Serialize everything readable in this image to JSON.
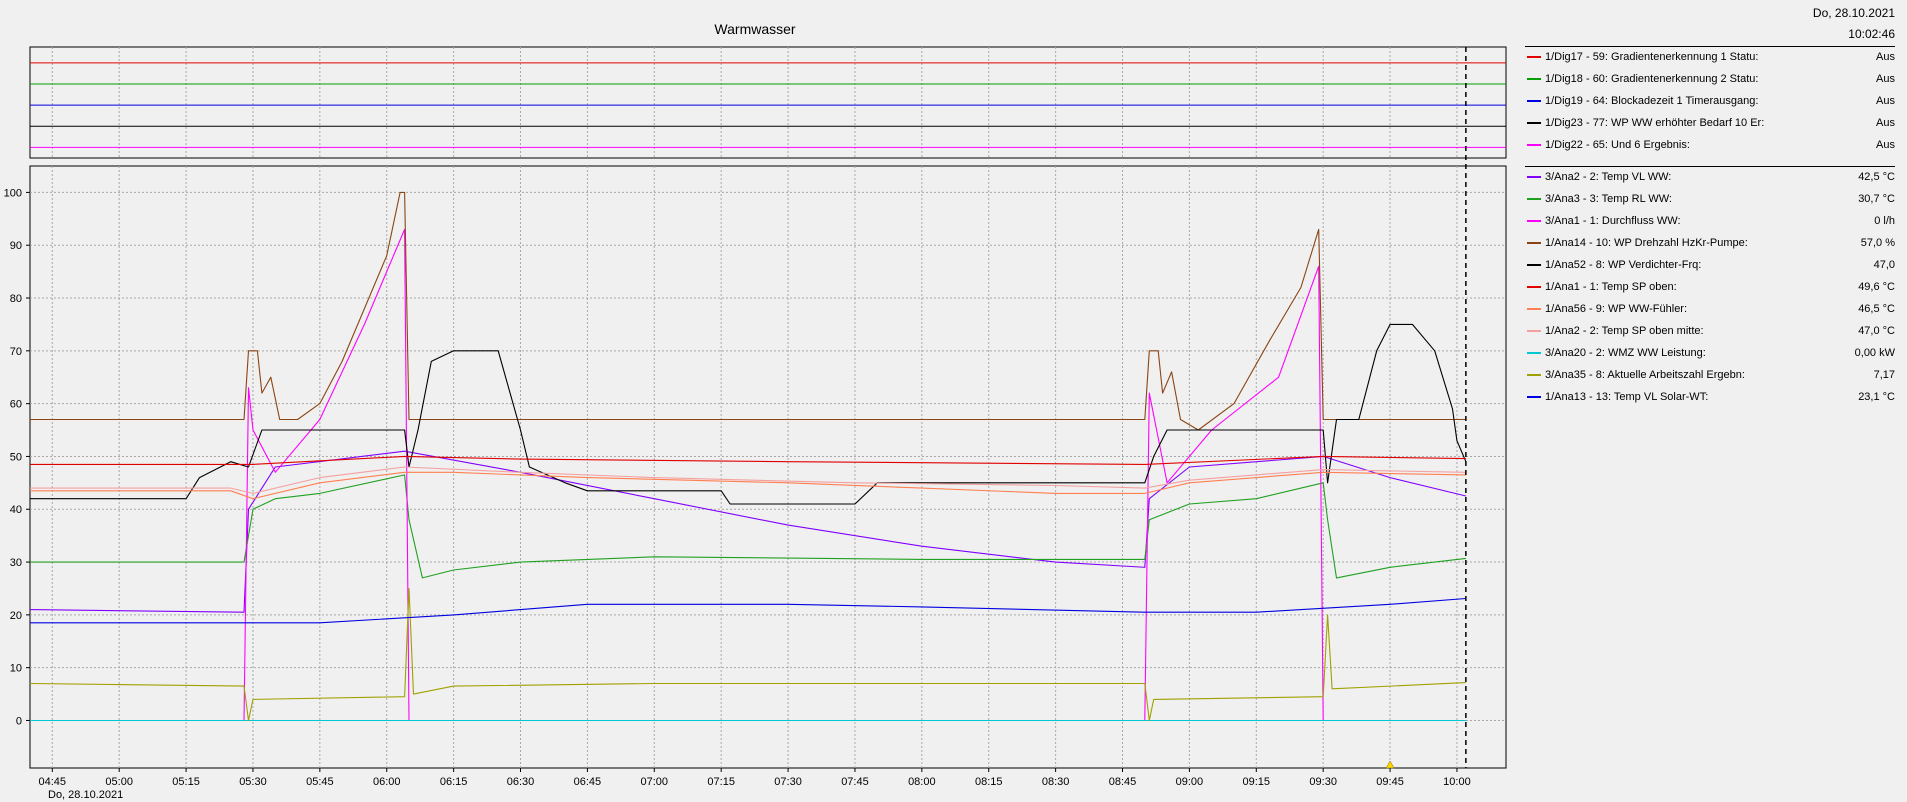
{
  "header": {
    "title": "Warmwasser",
    "date": "Do, 28.10.2021",
    "time": "10:02:46",
    "x_date": "Do, 28.10.2021"
  },
  "legend_digital": [
    {
      "label": "1/Dig17 - 59: Gradientenerkennung 1 Statu:",
      "value": "Aus",
      "color": "#e00000"
    },
    {
      "label": "1/Dig18 - 60: Gradientenerkennung 2 Statu:",
      "value": "Aus",
      "color": "#00a000"
    },
    {
      "label": "1/Dig19 - 64: Blockadezeit 1 Timerausgang:",
      "value": "Aus",
      "color": "#0000e0"
    },
    {
      "label": "1/Dig23 - 77: WP WW erhöhter Bedarf 10 Er:",
      "value": "Aus",
      "color": "#000000"
    },
    {
      "label": "1/Dig22 - 65: Und 6 Ergebnis:",
      "value": "Aus",
      "color": "#ff00ff"
    }
  ],
  "legend_analog": [
    {
      "label": "3/Ana2 - 2: Temp VL WW:",
      "value": "42,5 °C",
      "color": "#8000ff"
    },
    {
      "label": "3/Ana3 - 3: Temp RL WW:",
      "value": "30,7 °C",
      "color": "#20a020"
    },
    {
      "label": "3/Ana1 - 1: Durchfluss WW:",
      "value": "0 l/h",
      "color": "#ff00ff"
    },
    {
      "label": "1/Ana14 - 10: WP Drehzahl HzKr-Pumpe:",
      "value": "57,0 %",
      "color": "#8b4513"
    },
    {
      "label": "1/Ana52 - 8: WP Verdichter-Frq:",
      "value": "47,0",
      "color": "#000000"
    },
    {
      "label": "1/Ana1 - 1: Temp SP oben:",
      "value": "49,6 °C",
      "color": "#e00000"
    },
    {
      "label": "1/Ana56 - 9: WP WW-Fühler:",
      "value": "46,5 °C",
      "color": "#ff7f50"
    },
    {
      "label": "1/Ana2 - 2: Temp SP oben mitte:",
      "value": "47,0 °C",
      "color": "#f4a0a0"
    },
    {
      "label": "3/Ana20 - 2: WMZ WW Leistung:",
      "value": "0,00 kW",
      "color": "#00c8d0"
    },
    {
      "label": "3/Ana35 - 8: Aktuelle Arbeitszahl Ergebn:",
      "value": "7,17",
      "color": "#a0a000"
    },
    {
      "label": "1/Ana13 - 13: Temp VL Solar-WT:",
      "value": "23,1 °C",
      "color": "#0000e0"
    }
  ],
  "chart_data": {
    "type": "line",
    "title": "Warmwasser",
    "x_unit": "time (HH:MM) on 28.10.2021",
    "x_ticks": [
      "04:45",
      "05:00",
      "05:15",
      "05:30",
      "05:45",
      "06:00",
      "06:15",
      "06:30",
      "06:45",
      "07:00",
      "07:15",
      "07:30",
      "07:45",
      "08:00",
      "08:15",
      "08:30",
      "08:45",
      "09:00",
      "09:15",
      "09:30",
      "09:45",
      "10:00"
    ],
    "y_ticks": [
      0,
      10,
      20,
      30,
      40,
      50,
      60,
      70,
      80,
      90,
      100
    ],
    "ylim": [
      -9,
      105
    ],
    "xlim": [
      "04:40",
      "10:11"
    ],
    "cursor_time": "10:02",
    "grid": true,
    "digital_series": [
      {
        "name": "1/Dig17 - 59: Gradientenerkennung 1 Statu:",
        "state": 0
      },
      {
        "name": "1/Dig18 - 60: Gradientenerkennung 2 Statu:",
        "state": 0
      },
      {
        "name": "1/Dig19 - 64: Blockadezeit 1 Timerausgang:",
        "state": 0
      },
      {
        "name": "1/Dig23 - 77: WP WW erhöhter Bedarf 10 Er:",
        "state": 0
      },
      {
        "name": "1/Dig22 - 65: Und 6 Ergebnis:",
        "state": 0
      }
    ],
    "series": [
      {
        "name": "3/Ana2 - 2: Temp VL WW:",
        "points": [
          [
            "04:40",
            21
          ],
          [
            "05:28",
            20.5
          ],
          [
            "05:29",
            40
          ],
          [
            "05:35",
            48
          ],
          [
            "06:04",
            51
          ],
          [
            "06:30",
            47
          ],
          [
            "07:00",
            42
          ],
          [
            "07:30",
            37
          ],
          [
            "08:00",
            33
          ],
          [
            "08:30",
            30
          ],
          [
            "08:50",
            29
          ],
          [
            "08:51",
            42
          ],
          [
            "09:00",
            48
          ],
          [
            "09:30",
            50
          ],
          [
            "09:45",
            46
          ],
          [
            "10:02",
            42.5
          ]
        ]
      },
      {
        "name": "3/Ana3 - 3: Temp RL WW:",
        "points": [
          [
            "04:40",
            30
          ],
          [
            "05:28",
            30
          ],
          [
            "05:30",
            40
          ],
          [
            "05:35",
            42
          ],
          [
            "05:45",
            43
          ],
          [
            "06:04",
            46.5
          ],
          [
            "06:05",
            38
          ],
          [
            "06:08",
            27
          ],
          [
            "06:15",
            28.5
          ],
          [
            "06:30",
            30
          ],
          [
            "07:00",
            31
          ],
          [
            "08:00",
            30.5
          ],
          [
            "08:50",
            30.5
          ],
          [
            "08:51",
            38
          ],
          [
            "09:00",
            41
          ],
          [
            "09:15",
            42
          ],
          [
            "09:30",
            45
          ],
          [
            "09:31",
            38
          ],
          [
            "09:33",
            27
          ],
          [
            "09:45",
            29
          ],
          [
            "10:02",
            30.7
          ]
        ]
      },
      {
        "name": "3/Ana1 - 1: Durchfluss WW:",
        "points": [
          [
            "04:40",
            0
          ],
          [
            "05:28",
            0
          ],
          [
            "05:29",
            63
          ],
          [
            "05:30",
            55
          ],
          [
            "05:35",
            47
          ],
          [
            "05:45",
            57
          ],
          [
            "05:55",
            75
          ],
          [
            "06:04",
            93
          ],
          [
            "06:05",
            0
          ],
          [
            "08:50",
            0
          ],
          [
            "08:51",
            62
          ],
          [
            "08:55",
            45
          ],
          [
            "09:05",
            55
          ],
          [
            "09:20",
            65
          ],
          [
            "09:29",
            86
          ],
          [
            "09:30",
            0
          ],
          [
            "10:02",
            0
          ]
        ]
      },
      {
        "name": "1/Ana14 - 10: WP Drehzahl HzKr-Pumpe:",
        "points": [
          [
            "04:40",
            57
          ],
          [
            "05:28",
            57
          ],
          [
            "05:29",
            70
          ],
          [
            "05:31",
            70
          ],
          [
            "05:32",
            62
          ],
          [
            "05:34",
            65
          ],
          [
            "05:36",
            57
          ],
          [
            "05:40",
            57
          ],
          [
            "05:45",
            60
          ],
          [
            "05:50",
            68
          ],
          [
            "05:55",
            78
          ],
          [
            "06:00",
            88
          ],
          [
            "06:03",
            100
          ],
          [
            "06:04",
            100
          ],
          [
            "06:05",
            57
          ],
          [
            "08:50",
            57
          ],
          [
            "08:51",
            70
          ],
          [
            "08:53",
            70
          ],
          [
            "08:54",
            62
          ],
          [
            "08:56",
            66
          ],
          [
            "08:58",
            57
          ],
          [
            "09:02",
            55
          ],
          [
            "09:10",
            60
          ],
          [
            "09:18",
            72
          ],
          [
            "09:25",
            82
          ],
          [
            "09:29",
            93
          ],
          [
            "09:30",
            57
          ],
          [
            "10:02",
            57
          ]
        ]
      },
      {
        "name": "1/Ana52 - 8: WP Verdichter-Frq:",
        "points": [
          [
            "04:40",
            42
          ],
          [
            "05:15",
            42
          ],
          [
            "05:18",
            46
          ],
          [
            "05:25",
            49
          ],
          [
            "05:29",
            48
          ],
          [
            "05:32",
            55
          ],
          [
            "06:04",
            55
          ],
          [
            "06:05",
            48
          ],
          [
            "06:07",
            55
          ],
          [
            "06:10",
            68
          ],
          [
            "06:15",
            70
          ],
          [
            "06:25",
            70
          ],
          [
            "06:27",
            64
          ],
          [
            "06:30",
            55
          ],
          [
            "06:32",
            48
          ],
          [
            "06:40",
            45
          ],
          [
            "06:45",
            43.5
          ],
          [
            "07:15",
            43.5
          ],
          [
            "07:17",
            41
          ],
          [
            "07:45",
            41
          ],
          [
            "07:50",
            45
          ],
          [
            "08:00",
            45
          ],
          [
            "08:50",
            45
          ],
          [
            "08:52",
            50
          ],
          [
            "08:55",
            55
          ],
          [
            "09:30",
            55
          ],
          [
            "09:31",
            45
          ],
          [
            "09:33",
            57
          ],
          [
            "09:38",
            57
          ],
          [
            "09:42",
            70
          ],
          [
            "09:45",
            75
          ],
          [
            "09:50",
            75
          ],
          [
            "09:55",
            70
          ],
          [
            "09:59",
            59
          ],
          [
            "10:00",
            53
          ],
          [
            "10:02",
            49
          ]
        ]
      },
      {
        "name": "1/Ana1 - 1: Temp SP oben:",
        "points": [
          [
            "04:40",
            48.5
          ],
          [
            "05:30",
            48.5
          ],
          [
            "06:04",
            50
          ],
          [
            "06:30",
            49.5
          ],
          [
            "07:30",
            49
          ],
          [
            "08:50",
            48.5
          ],
          [
            "09:30",
            50
          ],
          [
            "10:02",
            49.6
          ]
        ]
      },
      {
        "name": "1/Ana56 - 9: WP WW-Fühler:",
        "points": [
          [
            "04:40",
            43.5
          ],
          [
            "05:25",
            43.5
          ],
          [
            "05:30",
            42
          ],
          [
            "05:45",
            45
          ],
          [
            "06:04",
            47
          ],
          [
            "06:15",
            47
          ],
          [
            "06:45",
            46
          ],
          [
            "07:30",
            45
          ],
          [
            "08:00",
            44
          ],
          [
            "08:30",
            43
          ],
          [
            "08:50",
            43
          ],
          [
            "09:00",
            45
          ],
          [
            "09:30",
            47
          ],
          [
            "10:02",
            46.5
          ]
        ]
      },
      {
        "name": "1/Ana2 - 2: Temp SP oben mitte:",
        "points": [
          [
            "04:40",
            44
          ],
          [
            "05:25",
            44
          ],
          [
            "05:30",
            43
          ],
          [
            "05:45",
            46
          ],
          [
            "06:04",
            48
          ],
          [
            "06:30",
            47
          ],
          [
            "07:00",
            46
          ],
          [
            "07:45",
            45
          ],
          [
            "08:30",
            44.5
          ],
          [
            "08:50",
            44
          ],
          [
            "09:00",
            45.5
          ],
          [
            "09:30",
            47.5
          ],
          [
            "10:02",
            47
          ]
        ]
      },
      {
        "name": "3/Ana20 - 2: WMZ WW Leistung:",
        "points": [
          [
            "04:40",
            0
          ],
          [
            "10:02",
            0
          ]
        ]
      },
      {
        "name": "3/Ana35 - 8: Aktuelle Arbeitszahl Ergebn:",
        "points": [
          [
            "04:40",
            7
          ],
          [
            "05:28",
            6.5
          ],
          [
            "05:29",
            0
          ],
          [
            "05:30",
            4
          ],
          [
            "06:04",
            4.5
          ],
          [
            "06:05",
            25
          ],
          [
            "06:06",
            5
          ],
          [
            "06:15",
            6.5
          ],
          [
            "07:00",
            7
          ],
          [
            "08:00",
            7
          ],
          [
            "08:50",
            7
          ],
          [
            "08:51",
            0
          ],
          [
            "08:52",
            4
          ],
          [
            "09:30",
            4.5
          ],
          [
            "09:31",
            20
          ],
          [
            "09:32",
            6
          ],
          [
            "10:02",
            7.17
          ]
        ]
      },
      {
        "name": "1/Ana13 - 13: Temp VL Solar-WT:",
        "points": [
          [
            "04:40",
            18.5
          ],
          [
            "05:45",
            18.5
          ],
          [
            "06:15",
            20
          ],
          [
            "06:45",
            22
          ],
          [
            "07:30",
            22
          ],
          [
            "08:00",
            21.5
          ],
          [
            "08:50",
            20.5
          ],
          [
            "09:15",
            20.5
          ],
          [
            "09:45",
            22
          ],
          [
            "10:02",
            23.1
          ]
        ]
      }
    ]
  }
}
